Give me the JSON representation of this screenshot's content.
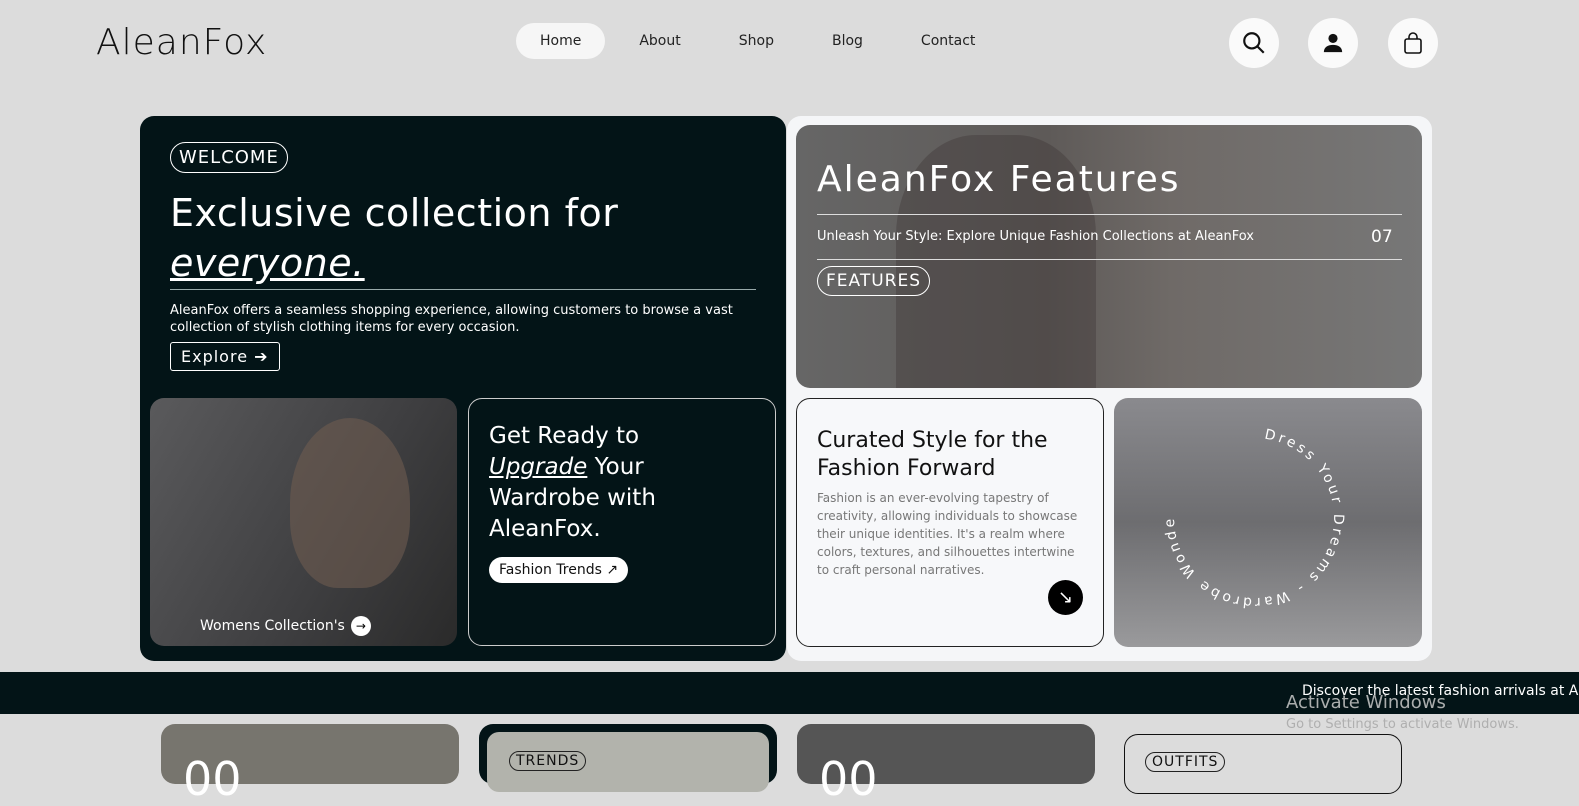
{
  "header": {
    "logo": "AleanFox",
    "nav": [
      "Home",
      "About",
      "Shop",
      "Blog",
      "Contact"
    ],
    "active": "Home",
    "icons": [
      "search-icon",
      "user-icon",
      "shopping-bag-icon"
    ]
  },
  "hero": {
    "badge": "WELCOME",
    "title_line1": "Exclusive collection for",
    "title_line2": "everyone.",
    "description": "AleanFox offers a seamless shopping experience, allowing customers to browse a vast collection of stylish clothing items for every occasion.",
    "explore_label": "Explore",
    "womens_label": "Womens Collection's",
    "upgrade": {
      "l1": "Get Ready to",
      "em": "Upgrade",
      "l2": " Your",
      "l3": "Wardrobe with",
      "l4": "AleanFox.",
      "button": "Fashion Trends"
    }
  },
  "features": {
    "title": "AleanFox Features",
    "subtitle": "Unleash Your Style: Explore Unique Fashion Collections at AleanFox",
    "number": "07",
    "badge": "FEATURES"
  },
  "curated": {
    "title": "Curated Style for the Fashion Forward",
    "body": "Fashion is an ever-evolving tapestry of creativity, allowing individuals to showcase their unique identities. It's a realm where colors, textures, and silhouettes intertwine to craft personal narratives."
  },
  "store": {
    "circular_text": "Dress Your Dreams - Wardrobe Wonders - "
  },
  "marquee": {
    "text": "Discover the latest fashion arrivals at AleanFox"
  },
  "bottom": {
    "badge_trends": "TRENDS",
    "badge_outfits": "OUTFITS",
    "num1": "00",
    "num2": "00"
  },
  "watermark": {
    "title": "Activate Windows",
    "subtitle": "Go to Settings to activate Windows."
  },
  "colors": {
    "dark": "#031417",
    "bg": "#dcdcdc"
  }
}
